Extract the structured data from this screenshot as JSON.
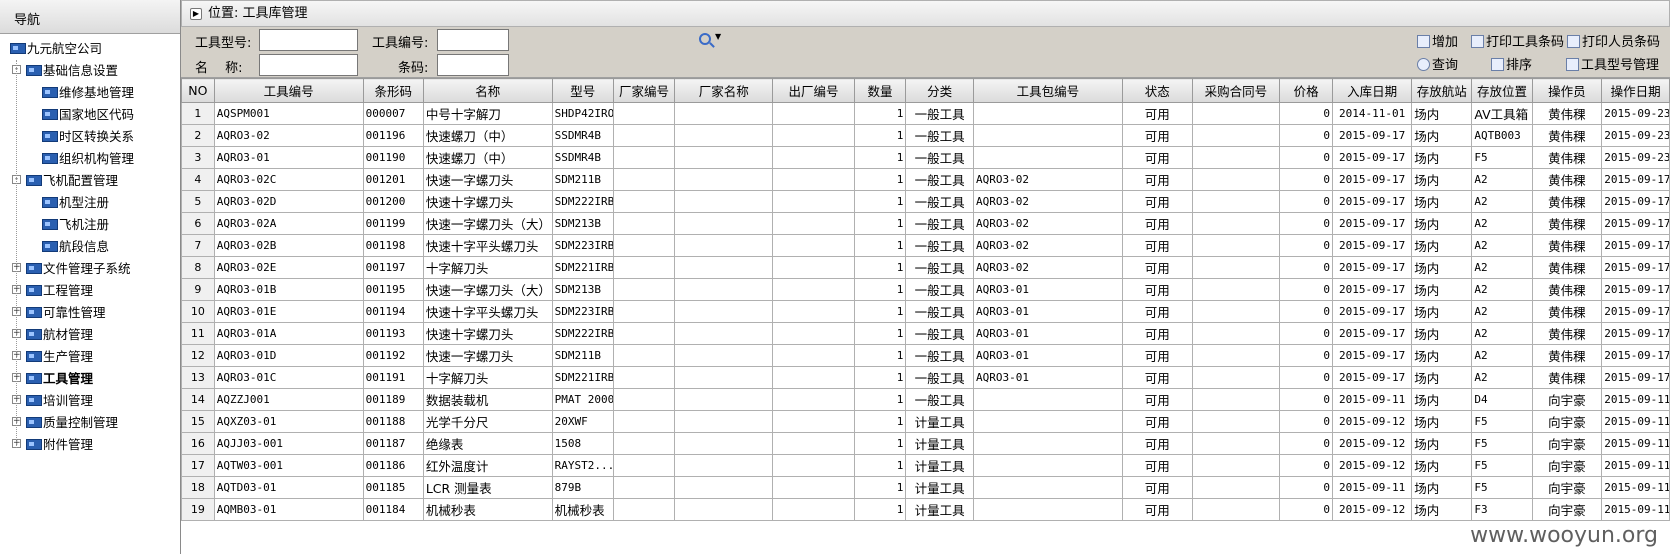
{
  "nav": {
    "title": "导航",
    "root": "九元航空公司",
    "nodes": [
      {
        "label": "基础信息设置",
        "expanded": true,
        "children": [
          "维修基地管理",
          "国家地区代码",
          "时区转换关系",
          "组织机构管理"
        ]
      },
      {
        "label": "飞机配置管理",
        "expanded": true,
        "children": [
          "机型注册",
          "飞机注册",
          "航段信息"
        ]
      },
      {
        "label": "文件管理子系统",
        "expanded": false
      },
      {
        "label": "工程管理",
        "expanded": false
      },
      {
        "label": "可靠性管理",
        "expanded": false
      },
      {
        "label": "航材管理",
        "expanded": false
      },
      {
        "label": "生产管理",
        "expanded": false
      },
      {
        "label": "工具管理",
        "expanded": false,
        "selected": true
      },
      {
        "label": "培训管理",
        "expanded": false
      },
      {
        "label": "质量控制管理",
        "expanded": false
      },
      {
        "label": "附件管理",
        "expanded": false
      }
    ]
  },
  "location": "位置: 工具库管理",
  "filters": {
    "tool_type_label": "工具型号:",
    "tool_type_value": "",
    "tool_no_label": "工具编号:",
    "tool_no_value": "",
    "name_label": "名　 称:",
    "name_value": "",
    "barcode_label": "条码:",
    "barcode_value": ""
  },
  "actions": {
    "add": "增加",
    "print_tool_barcode": "打印工具条码",
    "print_staff_barcode": "打印人员条码",
    "query": "查询",
    "sort": "排序",
    "tool_type_manage": "工具型号管理"
  },
  "table": {
    "columns": [
      "NO",
      "工具编号",
      "条形码",
      "名称",
      "型号",
      "厂家编号",
      "厂家名称",
      "出厂编号",
      "数量",
      "分类",
      "工具包编号",
      "状态",
      "采购合同号",
      "价格",
      "入库日期",
      "存放航站",
      "存放位置",
      "操作员",
      "操作日期"
    ],
    "rows": [
      [
        "1",
        "AQSPM001",
        "000007",
        "中号十字解刀",
        "SHDP42IRO",
        "",
        "",
        "",
        "1",
        "一般工具",
        "",
        "可用",
        "",
        "0",
        "2014-11-01",
        "场内",
        "AV工具箱",
        "黄伟稞",
        "2015-09-23"
      ],
      [
        "2",
        "AQRO3-02",
        "001196",
        "快速螺刀（中）",
        "SSDMR4B",
        "",
        "",
        "",
        "1",
        "一般工具",
        "",
        "可用",
        "",
        "0",
        "2015-09-17",
        "场内",
        "AQTB003",
        "黄伟稞",
        "2015-09-23"
      ],
      [
        "3",
        "AQRO3-01",
        "001190",
        "快速螺刀（中）",
        "SSDMR4B",
        "",
        "",
        "",
        "1",
        "一般工具",
        "",
        "可用",
        "",
        "0",
        "2015-09-17",
        "场内",
        "F5",
        "黄伟稞",
        "2015-09-23"
      ],
      [
        "4",
        "AQRO3-02C",
        "001201",
        "快速一字螺刀头",
        "SDM211B",
        "",
        "",
        "",
        "1",
        "一般工具",
        "AQRO3-02",
        "可用",
        "",
        "0",
        "2015-09-17",
        "场内",
        "A2",
        "黄伟稞",
        "2015-09-17"
      ],
      [
        "5",
        "AQRO3-02D",
        "001200",
        "快速十字螺刀头",
        "SDM222IRB",
        "",
        "",
        "",
        "1",
        "一般工具",
        "AQRO3-02",
        "可用",
        "",
        "0",
        "2015-09-17",
        "场内",
        "A2",
        "黄伟稞",
        "2015-09-17"
      ],
      [
        "6",
        "AQRO3-02A",
        "001199",
        "快速一字螺刀头（大）",
        "SDM213B",
        "",
        "",
        "",
        "1",
        "一般工具",
        "AQRO3-02",
        "可用",
        "",
        "0",
        "2015-09-17",
        "场内",
        "A2",
        "黄伟稞",
        "2015-09-17"
      ],
      [
        "7",
        "AQRO3-02B",
        "001198",
        "快速十字平头螺刀头",
        "SDM223IRB",
        "",
        "",
        "",
        "1",
        "一般工具",
        "AQRO3-02",
        "可用",
        "",
        "0",
        "2015-09-17",
        "场内",
        "A2",
        "黄伟稞",
        "2015-09-17"
      ],
      [
        "8",
        "AQRO3-02E",
        "001197",
        "十字解刀头",
        "SDM221IRB",
        "",
        "",
        "",
        "1",
        "一般工具",
        "AQRO3-02",
        "可用",
        "",
        "0",
        "2015-09-17",
        "场内",
        "A2",
        "黄伟稞",
        "2015-09-17"
      ],
      [
        "9",
        "AQRO3-01B",
        "001195",
        "快速一字螺刀头（大）",
        "SDM213B",
        "",
        "",
        "",
        "1",
        "一般工具",
        "AQRO3-01",
        "可用",
        "",
        "0",
        "2015-09-17",
        "场内",
        "A2",
        "黄伟稞",
        "2015-09-17"
      ],
      [
        "10",
        "AQRO3-01E",
        "001194",
        "快速十字平头螺刀头",
        "SDM223IRB",
        "",
        "",
        "",
        "1",
        "一般工具",
        "AQRO3-01",
        "可用",
        "",
        "0",
        "2015-09-17",
        "场内",
        "A2",
        "黄伟稞",
        "2015-09-17"
      ],
      [
        "11",
        "AQRO3-01A",
        "001193",
        "快速十字螺刀头",
        "SDM222IRB",
        "",
        "",
        "",
        "1",
        "一般工具",
        "AQRO3-01",
        "可用",
        "",
        "0",
        "2015-09-17",
        "场内",
        "A2",
        "黄伟稞",
        "2015-09-17"
      ],
      [
        "12",
        "AQRO3-01D",
        "001192",
        "快速一字螺刀头",
        "SDM211B",
        "",
        "",
        "",
        "1",
        "一般工具",
        "AQRO3-01",
        "可用",
        "",
        "0",
        "2015-09-17",
        "场内",
        "A2",
        "黄伟稞",
        "2015-09-17"
      ],
      [
        "13",
        "AQRO3-01C",
        "001191",
        "十字解刀头",
        "SDM221IRB",
        "",
        "",
        "",
        "1",
        "一般工具",
        "AQRO3-01",
        "可用",
        "",
        "0",
        "2015-09-17",
        "场内",
        "A2",
        "黄伟稞",
        "2015-09-17"
      ],
      [
        "14",
        "AQZZJ001",
        "001189",
        "数据装载机",
        "PMAT 2000",
        "",
        "",
        "",
        "1",
        "一般工具",
        "",
        "可用",
        "",
        "0",
        "2015-09-11",
        "场内",
        "D4",
        "向宇豪",
        "2015-09-11"
      ],
      [
        "15",
        "AQXZ03-01",
        "001188",
        "光学千分尺",
        "20XWF",
        "",
        "",
        "",
        "1",
        "计量工具",
        "",
        "可用",
        "",
        "0",
        "2015-09-12",
        "场内",
        "F5",
        "向宇豪",
        "2015-09-11"
      ],
      [
        "16",
        "AQJJ03-001",
        "001187",
        "绝缘表",
        "1508",
        "",
        "",
        "",
        "1",
        "计量工具",
        "",
        "可用",
        "",
        "0",
        "2015-09-12",
        "场内",
        "F5",
        "向宇豪",
        "2015-09-11"
      ],
      [
        "17",
        "AQTW03-001",
        "001186",
        "红外温度计",
        "RAYST2...",
        "",
        "",
        "",
        "1",
        "计量工具",
        "",
        "可用",
        "",
        "0",
        "2015-09-12",
        "场内",
        "F5",
        "向宇豪",
        "2015-09-11"
      ],
      [
        "18",
        "AQTD03-01",
        "001185",
        "LCR 测量表",
        "879B",
        "",
        "",
        "",
        "1",
        "计量工具",
        "",
        "可用",
        "",
        "0",
        "2015-09-11",
        "场内",
        "F5",
        "向宇豪",
        "2015-09-11"
      ],
      [
        "19",
        "AQMB03-01",
        "001184",
        "机械秒表",
        "机械秒表",
        "",
        "",
        "",
        "1",
        "计量工具",
        "",
        "可用",
        "",
        "0",
        "2015-09-12",
        "场内",
        "F3",
        "向宇豪",
        "2015-09-11"
      ]
    ]
  },
  "watermark": "www.wooyun.org"
}
